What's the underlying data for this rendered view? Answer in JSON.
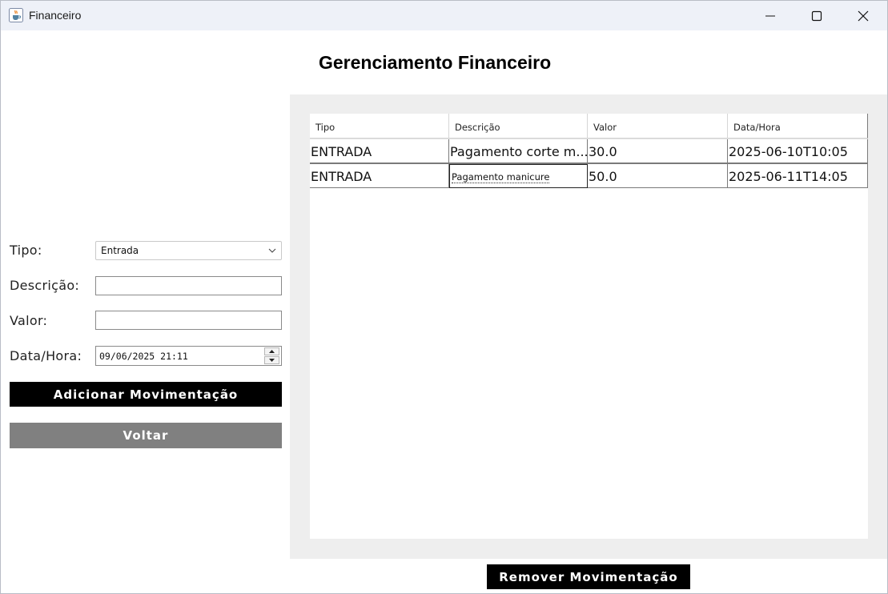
{
  "window": {
    "title": "Financeiro"
  },
  "header": {
    "title": "Gerenciamento Financeiro"
  },
  "form": {
    "tipo_label": "Tipo:",
    "tipo_value": "Entrada",
    "descricao_label": "Descrição:",
    "descricao_value": "",
    "valor_label": "Valor:",
    "valor_value": "",
    "datahora_label": "Data/Hora:",
    "datahora_value": "09/06/2025 21:11",
    "add_button": "Adicionar Movimentação",
    "back_button": "Voltar"
  },
  "table": {
    "columns": [
      "Tipo",
      "Descrição",
      "Valor",
      "Data/Hora"
    ],
    "rows": [
      [
        "ENTRADA",
        "Pagamento corte m...",
        "30.0",
        "2025-06-10T10:05"
      ],
      [
        "ENTRADA",
        "Pagamento manicure",
        "50.0",
        "2025-06-11T14:05"
      ]
    ]
  },
  "actions": {
    "remove_button": "Remover Movimentação"
  },
  "colors": {
    "title_bar": "#eef1f8",
    "primary_button": "#000000",
    "secondary_button": "#808080",
    "panel_background": "#eeeeee"
  },
  "icons": {
    "app": "java-cup-icon",
    "minimize": "minimize-icon",
    "maximize": "maximize-icon",
    "close": "close-icon",
    "combo": "chevron-down-icon",
    "spin_up": "arrow-up-icon",
    "spin_down": "arrow-down-icon"
  }
}
